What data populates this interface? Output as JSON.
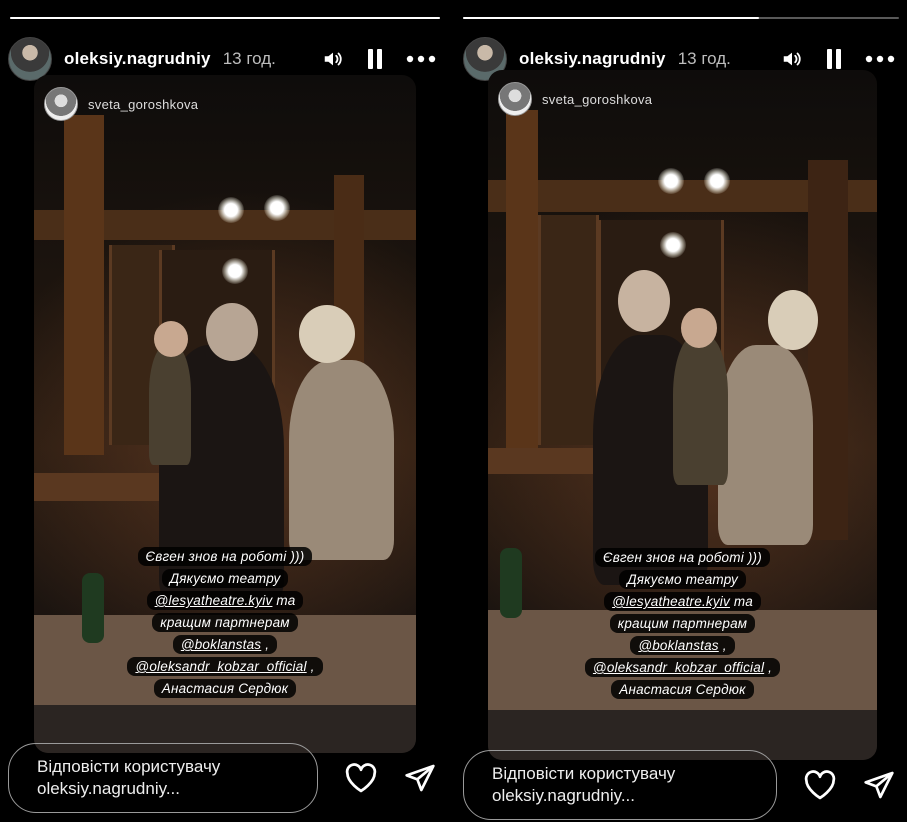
{
  "stories": [
    {
      "progress_fraction": 1.0,
      "user": {
        "username": "oleksiy.nagrudniy",
        "time": "13 год."
      },
      "controls": {
        "sound": "volume-icon",
        "pause": "pause-icon",
        "more": "more-icon"
      },
      "repost": {
        "username": "sveta_goroshkova"
      },
      "caption": {
        "line1": "Євген знов на роботі )))",
        "line2": "Дякуємо театру",
        "line3a": "@lesyatheatre.kyiv",
        "line3b": " та",
        "line4": "кращим партнерам",
        "line5a": "@boklanstas",
        "line5b": " ,",
        "line6a": "@oleksandr_kobzar_official",
        "line6b": " ,",
        "line7": "Анастасия Сердюк"
      },
      "reply": {
        "line1": "Відповісти користувачу",
        "line2": "oleksiy.nagrudniy..."
      },
      "actions": {
        "like": "heart-icon",
        "share": "send-icon"
      }
    },
    {
      "progress_fraction": 0.68,
      "user": {
        "username": "oleksiy.nagrudniy",
        "time": "13 год."
      },
      "controls": {
        "sound": "volume-icon",
        "pause": "pause-icon",
        "more": "more-icon"
      },
      "repost": {
        "username": "sveta_goroshkova"
      },
      "caption": {
        "line1": "Євген знов на роботі )))",
        "line2": "Дякуємо театру",
        "line3a": "@lesyatheatre.kyiv",
        "line3b": " та",
        "line4": "кращим партнерам",
        "line5a": "@boklanstas",
        "line5b": " ,",
        "line6a": "@oleksandr_kobzar_official",
        "line6b": " ,",
        "line7": "Анастасия Сердюк"
      },
      "reply": {
        "line1": "Відповісти користувачу",
        "line2": "oleksiy.nagrudniy..."
      },
      "actions": {
        "like": "heart-icon",
        "share": "send-icon"
      }
    }
  ]
}
